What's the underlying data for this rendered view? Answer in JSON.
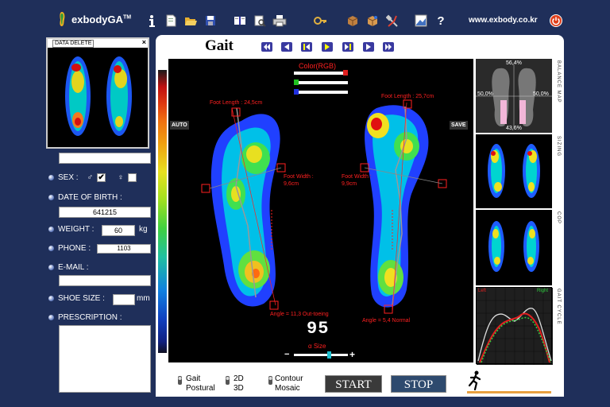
{
  "app": {
    "name": "exbodyGA",
    "tm": "TM",
    "website": "www.exbody.co.kr"
  },
  "toolbar": [
    "info-icon",
    "note-icon",
    "open-folder-icon",
    "save-disk-icon",
    "book-icon",
    "print-preview-icon",
    "printer-icon",
    "key-icon",
    "package-icon",
    "box-icon",
    "tools-icon",
    "image-edit-icon",
    "help-icon"
  ],
  "left": {
    "thumb_delete": "DATA DELETE",
    "thumb_close": "×",
    "name_value": "",
    "sex_label": "SEX :",
    "male_symbol": "♂",
    "male_checked": "✔",
    "female_symbol": "♀",
    "female_checked": "",
    "dob_label": "DATE OF BIRTH :",
    "dob_value": "641215",
    "weight_label": "WEIGHT :",
    "weight_value": "60",
    "weight_unit": "kg",
    "phone_label": "PHONE :",
    "phone_value": "1103",
    "email_label": "E-MAIL :",
    "email_value": "",
    "shoe_label": "SHOE SIZE :",
    "shoe_value": "",
    "shoe_unit": "mm",
    "prescription_label": "PRESCRIPTION :",
    "prescription_value": ""
  },
  "main": {
    "title": "Gait",
    "auto": "AUTO",
    "save": "SAVE",
    "color_label": "Color(RGB)",
    "left_foot_length": "Foot Length : 24,5cm",
    "right_foot_length": "Foot Length : 25,7cm",
    "left_foot_width": "Foot Width : 9,6cm",
    "right_foot_width": "Foot Width : 9,9cm",
    "left_angle": "Angle = 11,3 Out-toeing",
    "right_angle": "Angle = 5,4 Normal",
    "score": "95",
    "size_label": "α Size",
    "minus": "−",
    "plus": "+"
  },
  "balance": {
    "top": "56,4%",
    "bottom": "43,6%",
    "left": "50,0%",
    "right": "50,0%"
  },
  "side_labels": {
    "balance": "BALANCE MAP",
    "sizing": "SIZING",
    "cop": "COP",
    "cycle": "GAIT CYCLE"
  },
  "cycle": {
    "left": "Left",
    "right": "Right"
  },
  "modes": {
    "gait": "Gait",
    "postural": "Postural",
    "d2": "2D",
    "d3": "3D",
    "contour": "Contour",
    "mosaic": "Mosaic"
  },
  "buttons": {
    "start": "START",
    "stop": "STOP"
  },
  "colors": {
    "background": "#1f2f5a",
    "panel": "#ffffff",
    "annotation": "#ff2020",
    "start_bg": "#3a3a3a",
    "stop_bg": "#2e4a6e"
  }
}
